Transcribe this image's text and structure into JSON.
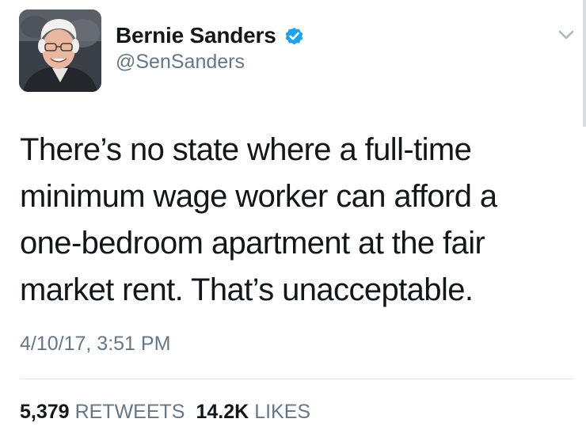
{
  "author": {
    "display_name": "Bernie Sanders",
    "handle": "@SenSanders",
    "verified": true,
    "avatar": "profile-photo"
  },
  "tweet": {
    "text_lines": [
      "There’s no state where a full-time",
      "minimum wage worker can afford a",
      "one-bedroom apartment at the fair",
      "market rent. That’s unacceptable."
    ],
    "timestamp": "4/10/17, 3:51 PM"
  },
  "stats": {
    "retweets_count": "5,379",
    "retweets_label": "RETWEETS",
    "likes_count": "14.2K",
    "likes_label": "LIKES"
  },
  "icons": {
    "verified": "verified-badge-icon",
    "menu": "chevron-down-icon"
  },
  "colors": {
    "verified_blue": "#1da1f2",
    "secondary_text": "#657786",
    "primary_text": "#14171a"
  }
}
